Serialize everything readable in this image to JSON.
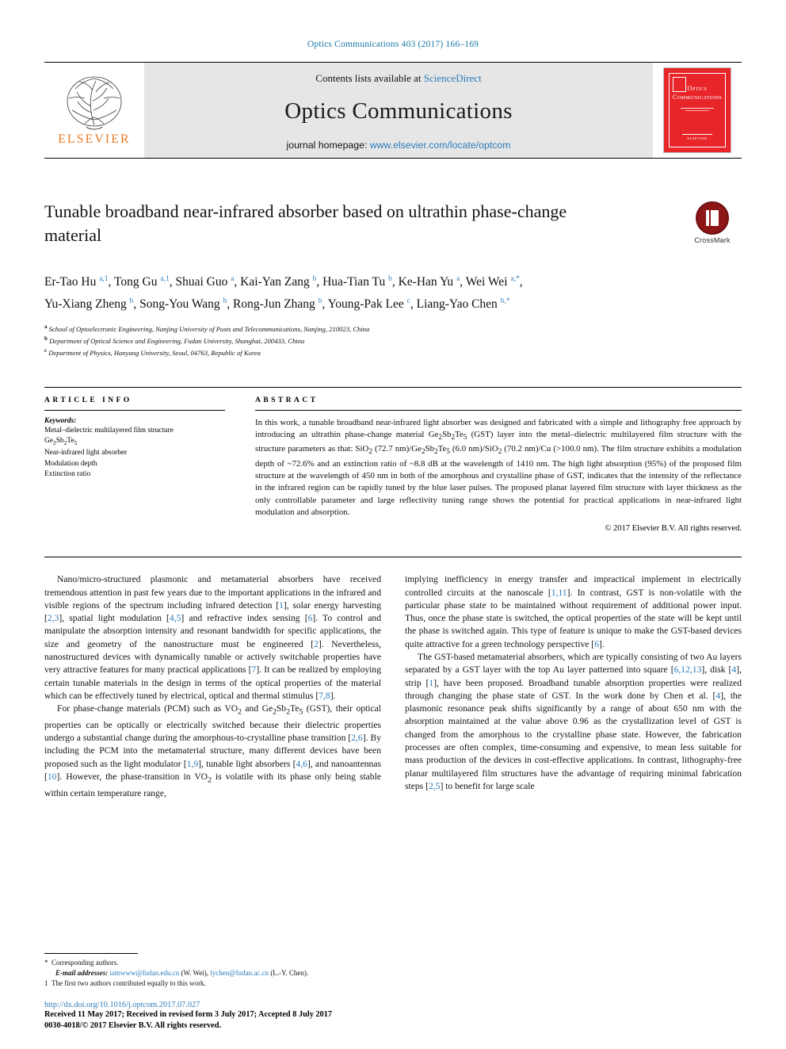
{
  "running_head": "Optics Communications 403 (2017) 166–169",
  "masthead": {
    "publisher_name": "ELSEVIER",
    "contents_prefix": "Contents lists available at ",
    "contents_link": "ScienceDirect",
    "journal_title": "Optics Communications",
    "homepage_prefix": "journal homepage: ",
    "homepage_link": "www.elsevier.com/locate/optcom",
    "cover_title_line1": "Optics",
    "cover_title_line2": "Communications",
    "cover_bottom": "ELSEVIER"
  },
  "article": {
    "title": "Tunable broadband near-infrared absorber based on ultrathin phase-change material",
    "crossmark_label": "CrossMark",
    "authors_line1": "Er-Tao Hu a,1, Tong Gu a,1, Shuai Guo a, Kai-Yan Zang b, Hua-Tian Tu b, Ke-Han Yu a, Wei Wei a,*,",
    "authors_line2": "Yu-Xiang Zheng b, Song-You Wang b, Rong-Jun Zhang b, Young-Pak Lee c, Liang-Yao Chen b,*",
    "affiliations": [
      "School of Optoelectronic Engineering, Nanjing University of Posts and Telecommunications, Nanjing, 210023, China",
      "Department of Optical Science and Engineering, Fudan University, Shanghai, 200433, China",
      "Department of Physics, Hanyang University, Seoul, 04763, Republic of Korea"
    ],
    "affiliation_marks": [
      "a",
      "b",
      "c"
    ]
  },
  "info": {
    "heading": "ARTICLE INFO",
    "keywords_label": "Keywords:",
    "keywords": [
      "Metal–dielectric multilayered film structure",
      "Ge2Sb2Te5",
      "Near-infrared light absorber",
      "Modulation depth",
      "Extinction ratio"
    ]
  },
  "abstract": {
    "heading": "ABSTRACT",
    "text": "In this work, a tunable broadband near-infrared light absorber was designed and fabricated with a simple and lithography free approach by introducing an ultrathin phase-change material Ge2Sb2Te5 (GST) layer into the metal–dielectric multilayered film structure with the structure parameters as that: SiO2 (72.7 nm)/Ge2Sb2Te5 (6.0 nm)/SiO2 (70.2 nm)/Cu (>100.0 nm). The film structure exhibits a modulation depth of ~72.6% and an extinction ratio of ~8.8 dB at the wavelength of 1410 nm. The high light absorption (95%) of the proposed film structure at the wavelength of 450 nm in both of the amorphous and crystalline phase of GST, indicates that the intensity of the reflectance in the infrared region can be rapidly tuned by the blue laser pulses. The proposed planar layered film structure with layer thickness as the only controllable parameter and large reflectivity tuning range shows the potential for practical applications in near-infrared light modulation and absorption.",
    "copyright": "© 2017 Elsevier B.V. All rights reserved."
  },
  "body": {
    "left_paragraphs": [
      "Nano/micro-structured plasmonic and metamaterial absorbers have received tremendous attention in past few years due to the important applications in the infrared and visible regions of the spectrum including infrared detection [1], solar energy harvesting [2,3], spatial light modulation [4,5] and refractive index sensing [6]. To control and manipulate the absorption intensity and resonant bandwidth for specific applications, the size and geometry of the nanostructure must be engineered [2]. Nevertheless, nanostructured devices with dynamically tunable or actively switchable properties have very attractive features for many practical applications [7]. It can be realized by employing certain tunable materials in the design in terms of the optical properties of the material which can be effectively tuned by electrical, optical and thermal stimulus [7,8].",
      "For phase-change materials (PCM) such as VO2 and Ge2Sb2Te5 (GST), their optical properties can be optically or electrically switched because their dielectric properties undergo a substantial change during the amorphous-to-crystalline phase transition [2,6]. By including the PCM into the metamaterial structure, many different devices have been proposed such as the light modulator [1,9], tunable light absorbers [4,6], and nanoantennas [10]. However, the phase-transition in VO2 is volatile with its phase only being stable within certain temperature range,"
    ],
    "right_paragraphs": [
      "implying inefficiency in energy transfer and impractical implement in electrically controlled circuits at the nanoscale [1,11]. In contrast, GST is non-volatile with the particular phase state to be maintained without requirement of additional power input. Thus, once the phase state is switched, the optical properties of the state will be kept until the phase is switched again. This type of feature is unique to make the GST-based devices quite attractive for a green technology perspective [6].",
      "The GST-based metamaterial absorbers, which are typically consisting of two Au layers separated by a GST layer with the top Au layer patterned into square [6,12,13], disk [4], strip [1], have been proposed. Broadband tunable absorption properties were realized through changing the phase state of GST. In the work done by Chen et al. [4], the plasmonic resonance peak shifts significantly by a range of about 650 nm with the absorption maintained at the value above 0.96 as the crystallization level of GST is changed from the amorphous to the crystalline phase state. However, the fabrication processes are often complex, time-consuming and expensive, to mean less suitable for mass production of the devices in cost-effective applications. In contrast, lithography-free planar multilayered film structures have the advantage of requiring minimal fabrication steps [2,5] to benefit for large scale"
    ]
  },
  "footnotes": {
    "corresponding": "Corresponding authors.",
    "email_label": "E-mail addresses:",
    "email1": "iamwww@fudan.edu.cn",
    "email1_owner": "(W. Wei),",
    "email2": "lychen@fudan.ac.cn",
    "email2_owner": "(L.-Y. Chen).",
    "equal_contrib": "The first two authors contributed equally to this work.",
    "mark_star": "*",
    "mark_one": "1"
  },
  "publication": {
    "doi": "http://dx.doi.org/10.1016/j.optcom.2017.07.027",
    "dates": "Received 11 May 2017; Received in revised form 3 July 2017; Accepted 8 July 2017",
    "issn_line": "0030-4018/© 2017 Elsevier B.V. All rights reserved."
  },
  "colors": {
    "link": "#2b7bba",
    "elsevier_orange": "#E87722",
    "cover_red": "#E8262A",
    "crossmark_red": "#8c1515"
  }
}
